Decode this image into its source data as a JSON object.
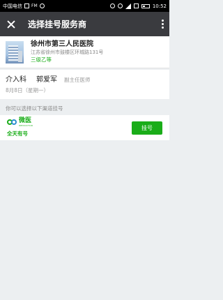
{
  "statusbar": {
    "carrier": "中国电信",
    "time": "10:52"
  },
  "header": {
    "title": "选择挂号服务商"
  },
  "hospital": {
    "name": "徐州市第三人民医院",
    "address": "江苏省徐州市鼓楼区环城路131号",
    "level": "三级乙等"
  },
  "doctor": {
    "department": "介入科",
    "name": "郭爱军",
    "title": "副主任医师",
    "date": "8月8日（星期一）"
  },
  "channels_label": "你可以选择以下渠道挂号",
  "channels": [
    {
      "logo_text": "微医",
      "logo_sub": "WEDOCTOR",
      "availability": "全天有号",
      "button_label": "挂号"
    }
  ],
  "colors": {
    "accent": "#1aad19",
    "header_bg": "#3a3b3f"
  }
}
